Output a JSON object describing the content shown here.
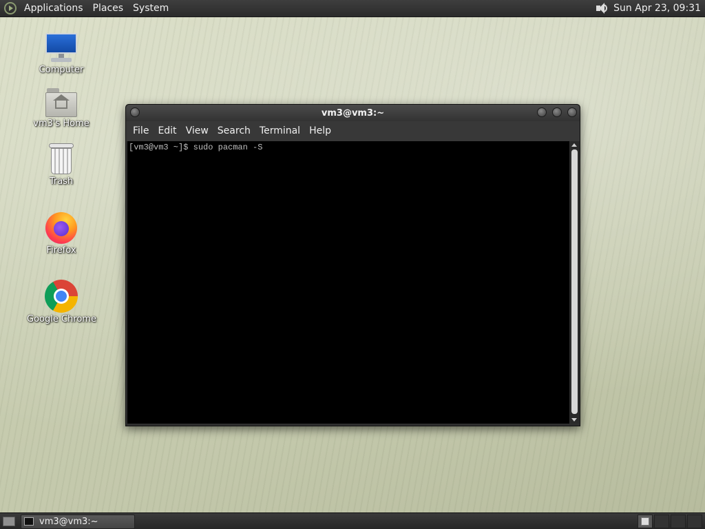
{
  "top_panel": {
    "menus": [
      "Applications",
      "Places",
      "System"
    ],
    "clock": "Sun Apr 23, 09:31"
  },
  "desktop_icons": [
    {
      "label": "Computer",
      "icon": "computer-icon"
    },
    {
      "label": "vm3's Home",
      "icon": "home-folder-icon"
    },
    {
      "label": "Trash",
      "icon": "trash-icon"
    },
    {
      "label": "Firefox",
      "icon": "firefox-icon"
    },
    {
      "label": "Google Chrome",
      "icon": "chrome-icon"
    }
  ],
  "terminal": {
    "title": "vm3@vm3:~",
    "menus": [
      "File",
      "Edit",
      "View",
      "Search",
      "Terminal",
      "Help"
    ],
    "content": "[vm3@vm3 ~]$ sudo pacman -S"
  },
  "bottom_panel": {
    "task_label": "vm3@vm3:~"
  }
}
